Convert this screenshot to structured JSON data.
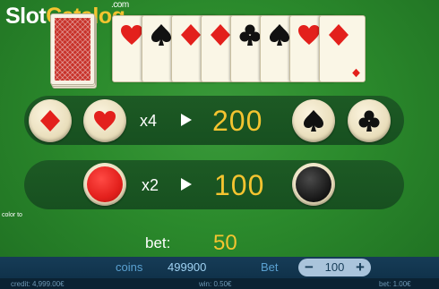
{
  "logo": {
    "slot": "Slot",
    "catalog": "Catalog",
    "com": ".com"
  },
  "cards": [
    {
      "suit": "heart",
      "color": "#e3201c"
    },
    {
      "suit": "spade",
      "color": "#111111"
    },
    {
      "suit": "diamond",
      "color": "#e3201c"
    },
    {
      "suit": "diamond",
      "color": "#e3201c"
    },
    {
      "suit": "club",
      "color": "#111111"
    },
    {
      "suit": "spade",
      "color": "#111111"
    },
    {
      "suit": "heart",
      "color": "#e3201c"
    },
    {
      "suit": "diamond",
      "color": "#e3201c"
    }
  ],
  "bets": {
    "suit": {
      "multiplier": "x4",
      "payout": "200",
      "buttons": [
        "diamond-icon",
        "heart-icon",
        "spade-icon",
        "club-icon"
      ]
    },
    "color": {
      "multiplier": "x2",
      "payout": "100",
      "buttons": [
        "red",
        "black"
      ]
    }
  },
  "side_label": "color to",
  "bet": {
    "label": "bet:",
    "value": "50"
  },
  "panel": {
    "coins_label": "coins",
    "coins_value": "499900",
    "bet_label": "Bet",
    "bet_value": "100",
    "minus": "−",
    "plus": "+"
  },
  "footer": {
    "credit": "credit: 4,999.00€",
    "win": "win: 0.50€",
    "bet": "bet: 1.00€"
  },
  "colors": {
    "accent": "#f4c430",
    "red": "#e3201c",
    "felt": "#2b8a2c",
    "panel": "#163c57"
  }
}
